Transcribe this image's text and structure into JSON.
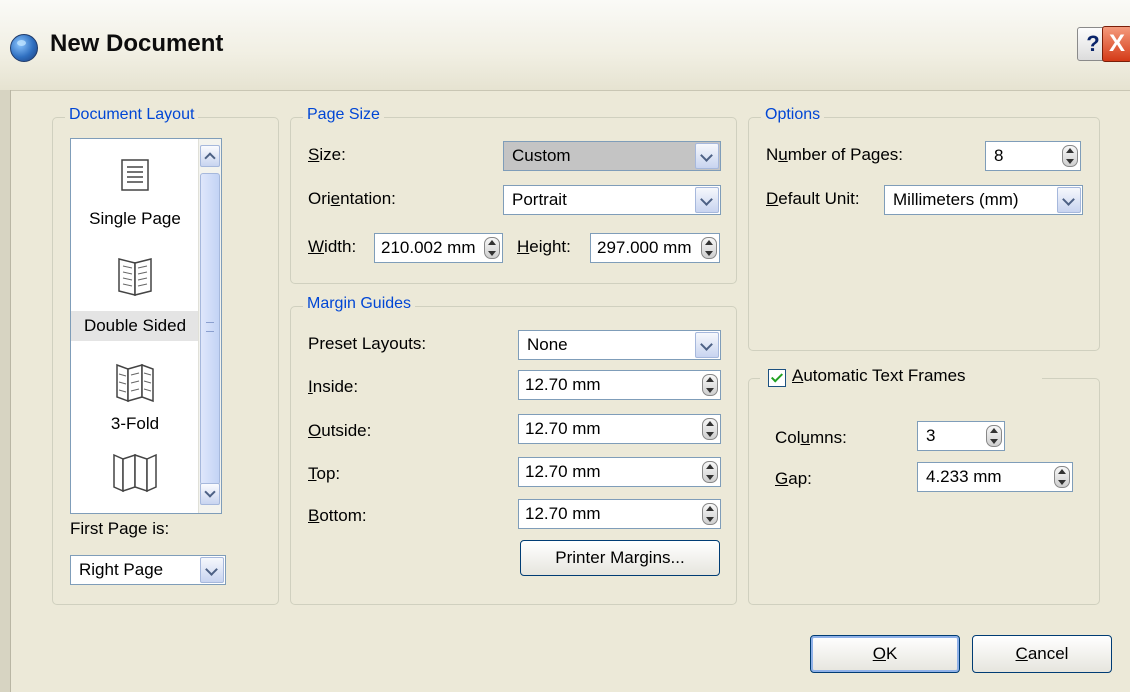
{
  "window": {
    "title": "New Document",
    "help_label": "?",
    "close_label": "X",
    "logo_icon": "globe-icon"
  },
  "document_layout": {
    "legend": "Document Layout",
    "items": [
      {
        "label": "Single Page",
        "icon": "single-page-icon"
      },
      {
        "label": "Double Sided",
        "icon": "double-sided-icon",
        "selected": true
      },
      {
        "label": "3-Fold",
        "icon": "three-fold-icon"
      },
      {
        "label": "",
        "icon": "four-fold-icon"
      }
    ],
    "first_page_label": "First Page is:",
    "first_page_value": "Right Page"
  },
  "page_size": {
    "legend": "Page Size",
    "size_label": "Size:",
    "size_value": "Custom",
    "orientation_label": "Orientation:",
    "orientation_value": "Portrait",
    "width_label": "Width:",
    "width_value": "210.002 mm",
    "height_label": "Height:",
    "height_value": "297.000 mm"
  },
  "margin_guides": {
    "legend": "Margin Guides",
    "preset_label": "Preset Layouts:",
    "preset_value": "None",
    "inside_label": "Inside:",
    "inside_value": "12.70 mm",
    "outside_label": "Outside:",
    "outside_value": "12.70 mm",
    "top_label": "Top:",
    "top_value": "12.70 mm",
    "bottom_label": "Bottom:",
    "bottom_value": "12.70 mm",
    "printer_margins_button": "Printer Margins..."
  },
  "options": {
    "legend": "Options",
    "num_pages_label": "Number of Pages:",
    "num_pages_value": "8",
    "default_unit_label": "Default Unit:",
    "default_unit_value": "Millimeters (mm)"
  },
  "text_frames": {
    "checkbox_label": "Automatic Text Frames",
    "checked": true,
    "columns_label": "Columns:",
    "columns_value": "3",
    "gap_label": "Gap:",
    "gap_value": "4.233 mm"
  },
  "buttons": {
    "ok": "OK",
    "cancel": "Cancel"
  },
  "colors": {
    "legend": "#0046d5",
    "dialog_bg": "#ece9d8",
    "field_border": "#7f9db9"
  }
}
